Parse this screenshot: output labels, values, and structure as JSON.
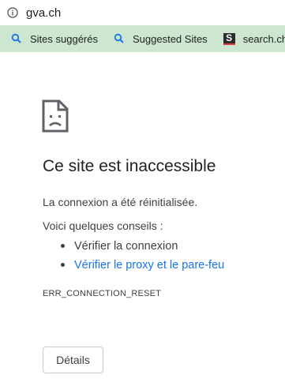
{
  "address_bar": {
    "icon": "info-icon",
    "url": "gva.ch"
  },
  "bookmarks": [
    {
      "icon": "search-icon",
      "label": "Sites suggérés"
    },
    {
      "icon": "search-icon",
      "label": "Suggested Sites"
    },
    {
      "icon": "search-ch-logo",
      "label": "search.ch"
    }
  ],
  "error_page": {
    "icon": "sad-document-icon",
    "title": "Ce site est inaccessible",
    "message": "La connexion a été réinitialisée.",
    "tips_heading": "Voici quelques conseils :",
    "tips": [
      {
        "label": "Vérifier la connexion",
        "link": false
      },
      {
        "label": "Vérifier le proxy et le pare-feu",
        "link": true
      }
    ],
    "error_code": "ERR_CONNECTION_RESET",
    "details_label": "Détails"
  },
  "colors": {
    "bookmarks_bar": "#cde6cf",
    "link": "#1a73e8",
    "text": "#202124"
  }
}
